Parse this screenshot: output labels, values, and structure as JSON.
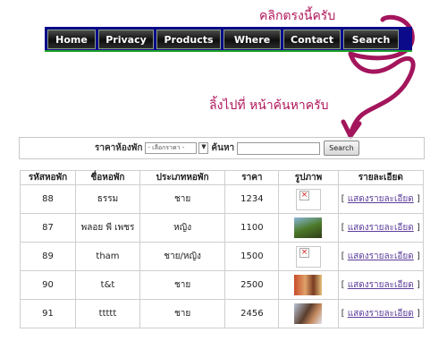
{
  "annotations": {
    "click_here": "คลิกตรงนี้ครับ",
    "link_to": "ลิ้งไปที่ หน้าค้นหาครับ"
  },
  "nav": {
    "items": [
      "Home",
      "Privacy",
      "Products",
      "Where",
      "Contact",
      "Search"
    ]
  },
  "search": {
    "price_label": "ราคาห้องพัก",
    "price_select": "- เลือกราคา -",
    "search_label": "ค้นหา",
    "button_label": "Search",
    "input_value": ""
  },
  "table": {
    "headers": [
      "รหัสหอพัก",
      "ชื่อหอพัก",
      "ประเภทหอพัก",
      "ราคา",
      "รูปภาพ",
      "รายละเอียด"
    ],
    "rows": [
      {
        "id": "88",
        "name": "ธรรม",
        "type": "ชาย",
        "price": "1234",
        "image": "broken",
        "detail": "แสดงรายละเอียด"
      },
      {
        "id": "87",
        "name": "พลอย พี เพชร",
        "type": "หญิง",
        "price": "1100",
        "image": "photo",
        "detail": "แสดงรายละเอียด"
      },
      {
        "id": "89",
        "name": "tham",
        "type": "ชาย/หญิง",
        "price": "1500",
        "image": "broken",
        "detail": "แสดงรายละเอียด"
      },
      {
        "id": "90",
        "name": "t&t",
        "type": "ชาย",
        "price": "2500",
        "image": "photo",
        "detail": "แสดงรายละเอียด"
      },
      {
        "id": "91",
        "name": "ttttt",
        "type": "ชาย",
        "price": "2456",
        "image": "photo",
        "detail": "แสดงรายละเอียด"
      }
    ]
  },
  "colors": {
    "annotation": "#b0185c",
    "nav_border": "#0a0a8a",
    "nav_accent": "#1fa22b",
    "link": "#5c3c99"
  }
}
